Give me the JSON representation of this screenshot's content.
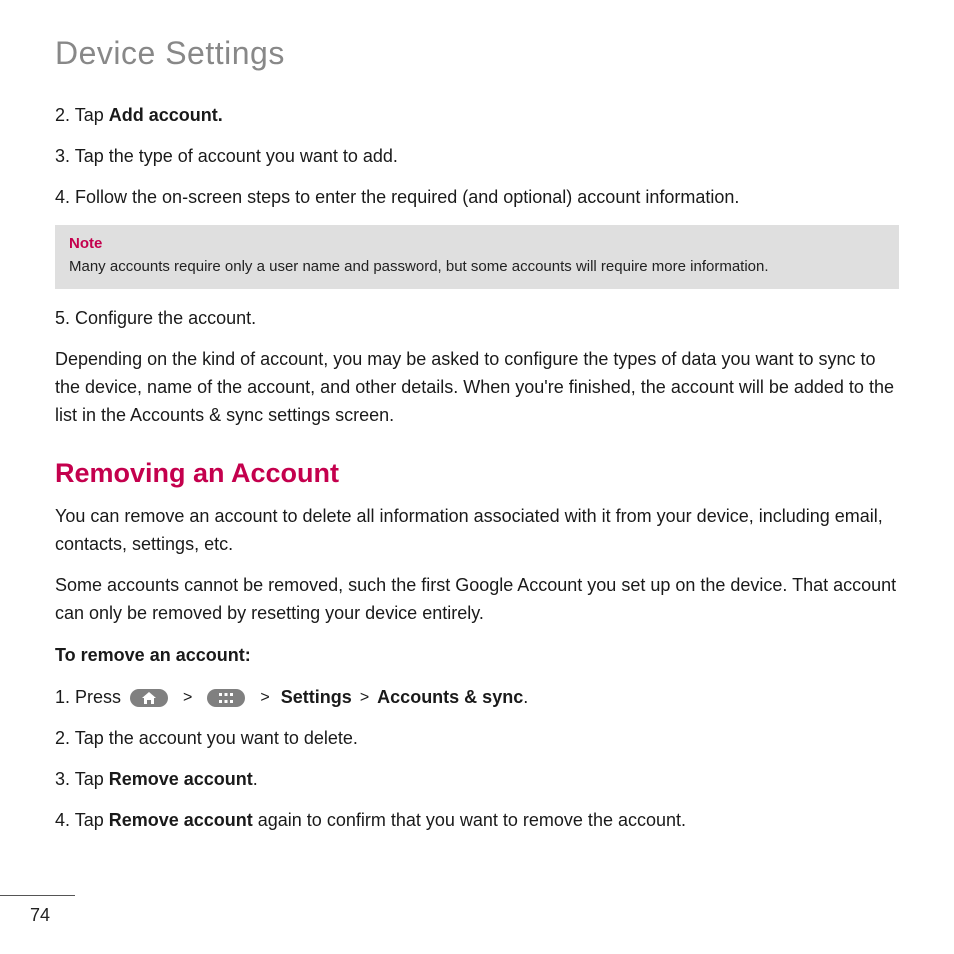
{
  "title": "Device Settings",
  "steps_a": {
    "s2_prefix": "2. Tap ",
    "s2_bold": "Add account.",
    "s3": "3. Tap the type of account you want to add.",
    "s4": "4. Follow the on-screen steps to enter the required (and optional) account information."
  },
  "note": {
    "label": "Note",
    "text": "Many accounts require only a user name and password, but some accounts will require more information."
  },
  "steps_b": {
    "s5": "5. Configure the account.",
    "para": "Depending on the kind of account, you may be asked to configure the types of data you want to sync to the device, name of the account, and other details. When you're finished, the account will be added to the list in the Accounts & sync settings screen."
  },
  "removing": {
    "heading": "Removing an Account",
    "para1": "You can remove an account to delete all information associated with it from your device, including email, contacts, settings, etc.",
    "para2": "Some accounts cannot be removed, such the first Google Account you set up on the device. That account can only be removed by resetting your device entirely.",
    "subhead": "To remove an account:",
    "s1_prefix": "1. Press ",
    "sep": ">",
    "s1_settings": "Settings",
    "s1_accounts": "Accounts & sync",
    "s1_period": ".",
    "s2": "2. Tap the account you want to delete.",
    "s3_prefix": "3. Tap ",
    "s3_bold": "Remove account",
    "s3_period": ".",
    "s4_prefix": "4. Tap ",
    "s4_bold": "Remove account",
    "s4_rest": " again to confirm that you want to remove the account."
  },
  "page_number": "74"
}
